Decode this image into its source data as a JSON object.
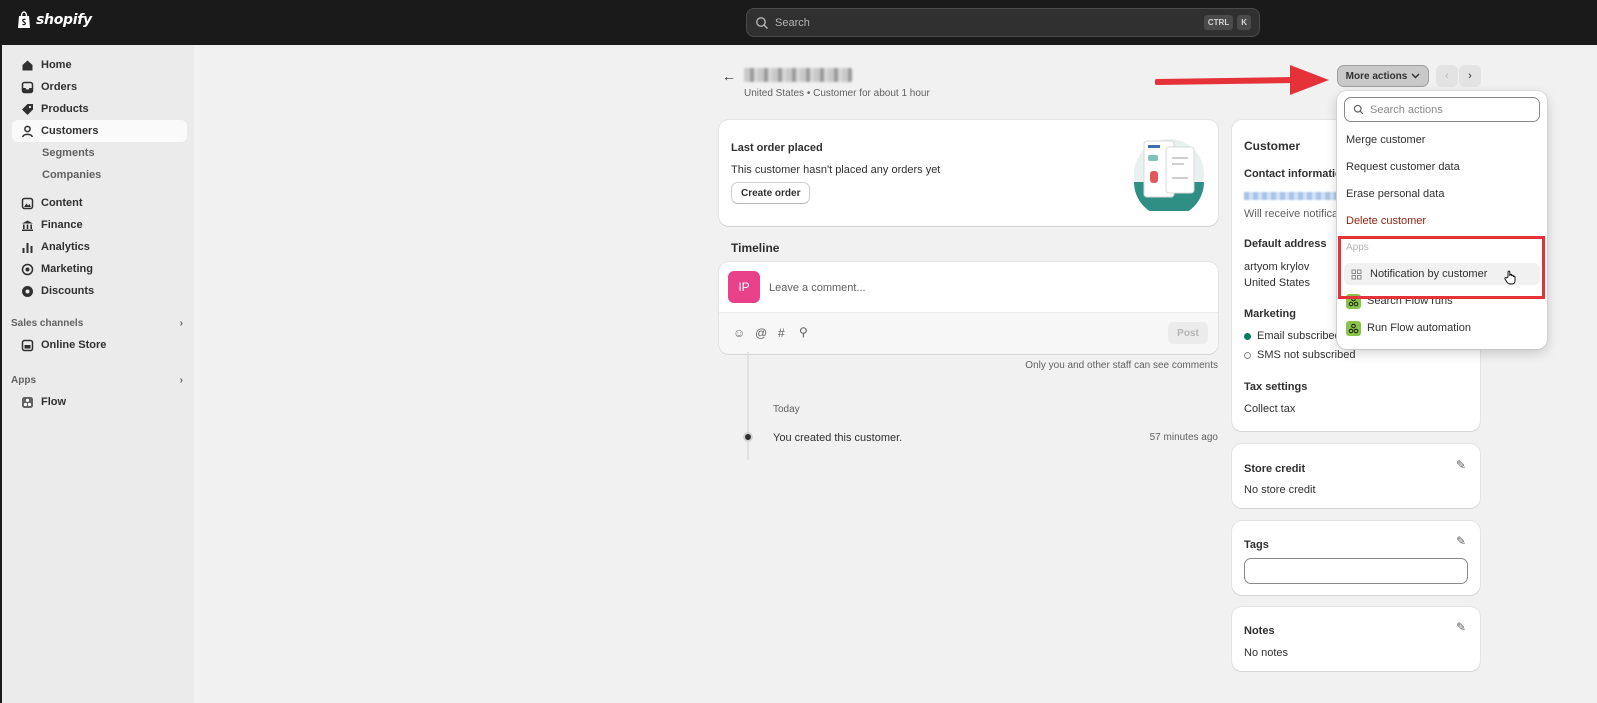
{
  "topbar": {
    "logo_text": "shopify",
    "search_placeholder": "Search",
    "kbd_ctrl": "CTRL",
    "kbd_k": "K"
  },
  "sidebar": {
    "items": [
      {
        "label": "Home",
        "icon": "home-icon"
      },
      {
        "label": "Orders",
        "icon": "inbox-icon"
      },
      {
        "label": "Products",
        "icon": "tag-icon"
      },
      {
        "label": "Customers",
        "icon": "person-icon"
      }
    ],
    "customers_sub": [
      "Segments",
      "Companies"
    ],
    "items2": [
      {
        "label": "Content",
        "icon": "content-icon"
      },
      {
        "label": "Finance",
        "icon": "bank-icon"
      },
      {
        "label": "Analytics",
        "icon": "chart-icon"
      },
      {
        "label": "Marketing",
        "icon": "target-icon"
      },
      {
        "label": "Discounts",
        "icon": "gear-discount-icon"
      }
    ],
    "sales_channels_label": "Sales channels",
    "online_store": "Online Store",
    "apps_label": "Apps",
    "flow": "Flow"
  },
  "header": {
    "subtitle": "United States • Customer for about 1 hour",
    "more_actions": "More actions"
  },
  "last_order": {
    "title": "Last order placed",
    "text": "This customer hasn't placed any orders yet",
    "button": "Create order"
  },
  "timeline": {
    "title": "Timeline",
    "avatar_initials": "IP",
    "comment_placeholder": "Leave a comment...",
    "post": "Post",
    "staff_note": "Only you and other staff can see comments",
    "day": "Today",
    "event": "You created this customer.",
    "event_time": "57 minutes ago"
  },
  "customer_card": {
    "title": "Customer",
    "contact_title": "Contact informatio",
    "notif_text": "Will receive notifica",
    "address_title": "Default address",
    "address_name": "artyom krylov",
    "address_country": "United States",
    "marketing_title": "Marketing",
    "email_status": "Email subscribed",
    "sms_status": "SMS not subscribed",
    "tax_title": "Tax settings",
    "tax_value": "Collect tax"
  },
  "store_credit": {
    "title": "Store credit",
    "value": "No store credit"
  },
  "tags": {
    "title": "Tags"
  },
  "notes": {
    "title": "Notes",
    "value": "No notes"
  },
  "dropdown": {
    "search_placeholder": "Search actions",
    "items": [
      "Merge customer",
      "Request customer data",
      "Erase personal data"
    ],
    "delete": "Delete customer",
    "apps_label": "Apps",
    "apps": [
      "Notification by customer",
      "Search Flow runs",
      "Run Flow automation"
    ]
  },
  "colors": {
    "topbar": "#1a1a1a",
    "accent_red": "#e53238",
    "avatar_pink": "#e8418a",
    "subscribed_green": "#047b5d",
    "flow_green": "#8bc34a"
  }
}
